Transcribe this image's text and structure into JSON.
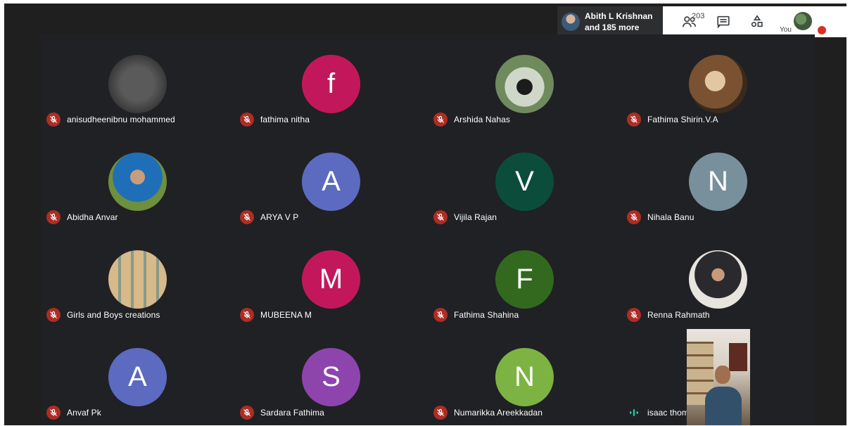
{
  "topbar": {
    "presenter_name": "Abith L Krishnan",
    "presenter_more": "and 185 more",
    "people_count": "203",
    "you_label": "You"
  },
  "participants": [
    {
      "name": "anisudheenibnu mohammed",
      "avatar_type": "image",
      "avatar_desc": "hp-logo",
      "muted": true
    },
    {
      "name": "fathima nitha",
      "avatar_type": "letter",
      "letter": "f",
      "color": "#c2185b",
      "muted": true
    },
    {
      "name": "Arshida Nahas",
      "avatar_type": "image",
      "avatar_desc": "photo-outdoor",
      "muted": true
    },
    {
      "name": "Fathima Shirin.V.A",
      "avatar_type": "image",
      "avatar_desc": "photo-painting",
      "muted": true
    },
    {
      "name": "Abidha Anvar",
      "avatar_type": "image",
      "avatar_desc": "photo-person-blue-scarf",
      "muted": true
    },
    {
      "name": "ARYA V P",
      "avatar_type": "letter",
      "letter": "A",
      "color": "#5c6bc0",
      "muted": true
    },
    {
      "name": "Vijila Rajan",
      "avatar_type": "letter",
      "letter": "V",
      "color": "#0b4d3a",
      "muted": true
    },
    {
      "name": "Nihala Banu",
      "avatar_type": "letter",
      "letter": "N",
      "color": "#78909c",
      "muted": true
    },
    {
      "name": "Girls and Boys creations",
      "avatar_type": "image",
      "avatar_desc": "paper-dolls",
      "muted": true
    },
    {
      "name": "MUBEENA M",
      "avatar_type": "letter",
      "letter": "M",
      "color": "#c2185b",
      "muted": true
    },
    {
      "name": "Fathima Shahina",
      "avatar_type": "letter",
      "letter": "F",
      "color": "#33691e",
      "muted": true
    },
    {
      "name": "Renna Rahmath",
      "avatar_type": "image",
      "avatar_desc": "photo-person-hijab",
      "muted": true
    },
    {
      "name": "Anvaf Pk",
      "avatar_type": "letter",
      "letter": "A",
      "color": "#5c6bc0",
      "muted": true
    },
    {
      "name": "Sardara Fathima",
      "avatar_type": "letter",
      "letter": "S",
      "color": "#8e44ad",
      "muted": true
    },
    {
      "name": "Numarikka Areekkadan",
      "avatar_type": "letter",
      "letter": "N",
      "color": "#7cb342",
      "muted": true
    },
    {
      "name": "isaac thomas",
      "avatar_type": "video",
      "muted": false
    }
  ],
  "colors": {
    "muted_badge": "#ad2d24",
    "speaking_indicator": "#1ec9a4"
  }
}
